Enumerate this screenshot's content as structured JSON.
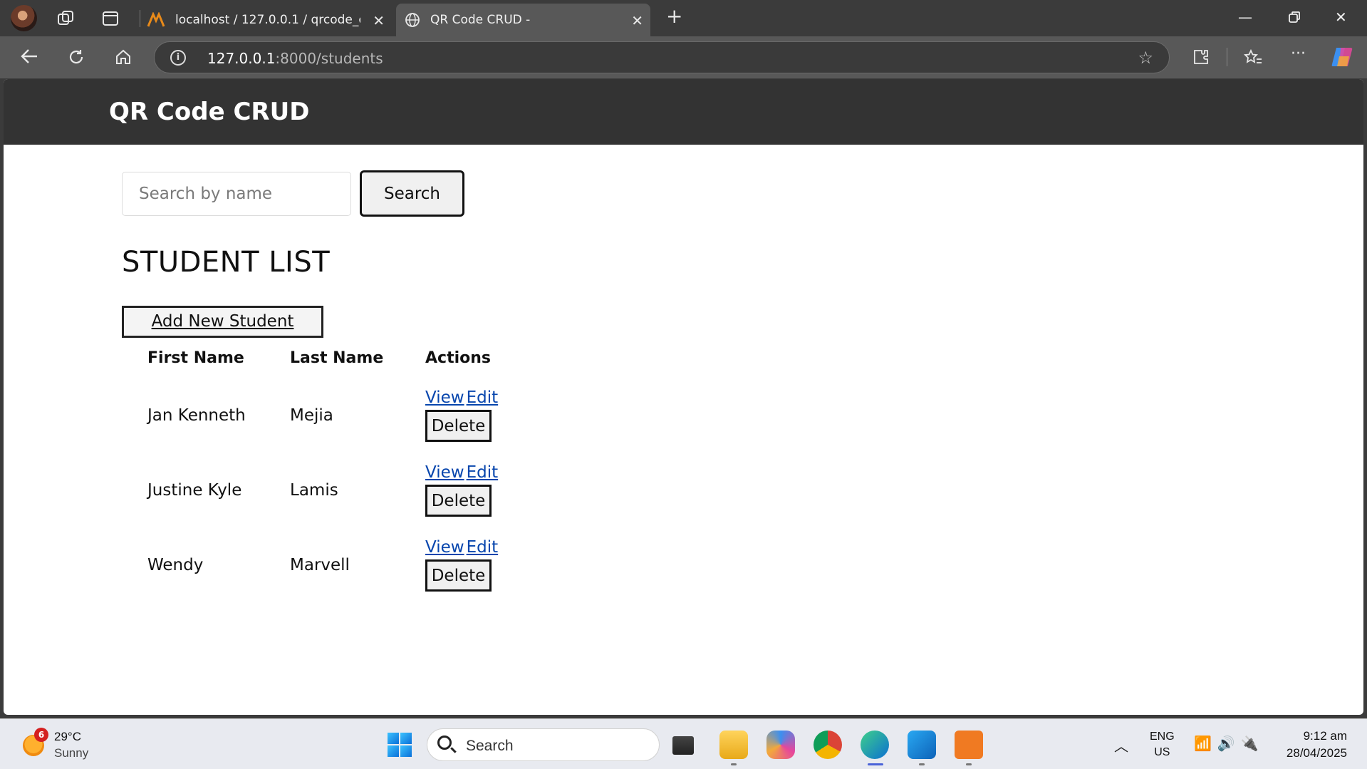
{
  "browser": {
    "tabs": [
      {
        "title": "localhost / 127.0.0.1 / qrcode_crud",
        "icon": "phpmyadmin-icon"
      },
      {
        "title": "QR Code CRUD -",
        "icon": "globe-icon",
        "active": true
      }
    ],
    "address": {
      "host": "127.0.0.1",
      "rest": ":8000/students"
    }
  },
  "page": {
    "brand": "QR Code CRUD",
    "search": {
      "placeholder": "Search by name",
      "value": "",
      "button_label": "Search"
    },
    "title": "STUDENT LIST",
    "add_button_label": "Add New Student",
    "table": {
      "headers": [
        "First Name",
        "Last Name",
        "Actions"
      ],
      "rows": [
        {
          "first": "Jan Kenneth",
          "last": "Mejia",
          "view": "View",
          "edit": "Edit",
          "delete": "Delete"
        },
        {
          "first": "Justine Kyle",
          "last": "Lamis",
          "view": "View",
          "edit": "Edit",
          "delete": "Delete"
        },
        {
          "first": "Wendy",
          "last": "Marvell",
          "view": "View",
          "edit": "Edit",
          "delete": "Delete"
        }
      ]
    },
    "link_color": "#0645ad",
    "navbar_color": "#333333"
  },
  "taskbar": {
    "weather": {
      "temp": "29°C",
      "condition": "Sunny",
      "badge": "6"
    },
    "search_label": "Search",
    "language": {
      "lang": "ENG",
      "region": "US"
    },
    "clock": {
      "time": "9:12 am",
      "date": "28/04/2025"
    }
  }
}
